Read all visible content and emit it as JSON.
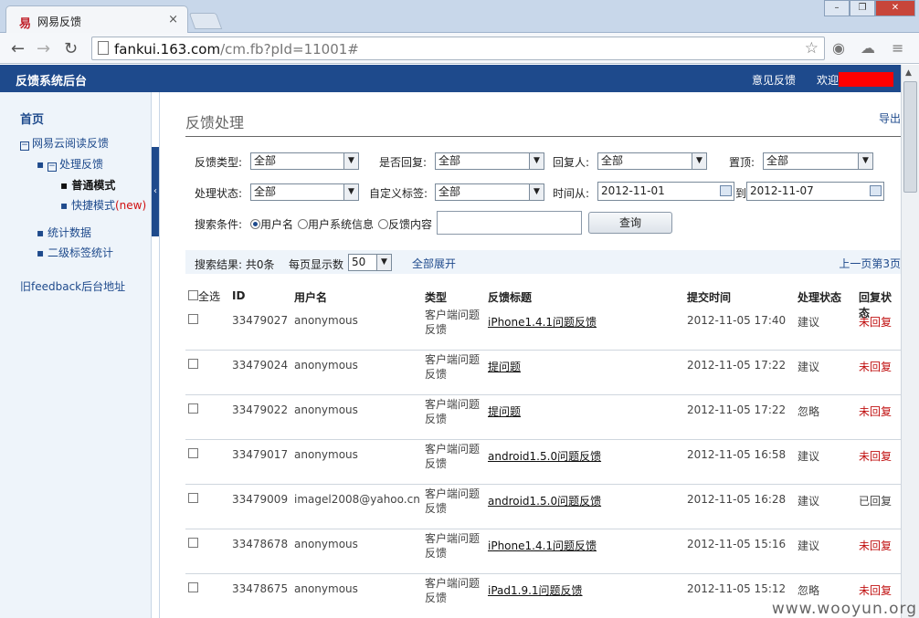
{
  "browser": {
    "tab_title": "网易反馈",
    "tab_close": "×",
    "url_host": "fankui.163.com",
    "url_rest": "/cm.fb?pId=11001#"
  },
  "header": {
    "app_title": "反馈系统后台",
    "feedback_link": "意见反馈",
    "welcome": "欢迎:"
  },
  "sidebar": {
    "home": "首页",
    "group": "网易云阅读反馈",
    "handle": "处理反馈",
    "normal_mode": "普通模式",
    "quick_mode": "快捷模式",
    "quick_new": "(new)",
    "stats": "统计数据",
    "tag_stats": "二级标签统计",
    "old_link": "旧feedback后台地址"
  },
  "main": {
    "title": "反馈处理",
    "export": "导出"
  },
  "filters": {
    "type_label": "反馈类型:",
    "type_value": "全部",
    "replied_label": "是否回复:",
    "replied_value": "全部",
    "replier_label": "回复人:",
    "replier_value": "全部",
    "top_label": "置顶:",
    "top_value": "全部",
    "status_label": "处理状态:",
    "status_value": "全部",
    "tag_label": "自定义标签:",
    "tag_value": "全部",
    "from_label": "时间从:",
    "from_value": "2012-11-01",
    "to_label": "到",
    "to_value": "2012-11-07",
    "cond_label": "搜索条件:",
    "opt_user": "用户名",
    "opt_sysinfo": "用户系统信息",
    "opt_content": "反馈内容",
    "search_value": "",
    "query_button": "查询"
  },
  "results": {
    "summary": "搜索结果: 共0条",
    "per_page_label": "每页显示数",
    "per_page_value": "50",
    "expand_all": "全部展开",
    "pager": "上一页第3页"
  },
  "table": {
    "headers": {
      "select_all": "全选",
      "id": "ID",
      "user": "用户名",
      "type": "类型",
      "title": "反馈标题",
      "time": "提交时间",
      "status": "处理状态",
      "reply": "回复状态"
    },
    "rows": [
      {
        "id": "33479027",
        "user": "anonymous",
        "type": "客户端问题反馈",
        "title": "iPhone1.4.1问题反馈",
        "time": "2012-11-05 17:40",
        "status": "建议",
        "reply": "未回复"
      },
      {
        "id": "33479024",
        "user": "anonymous",
        "type": "客户端问题反馈",
        "title": "提问题",
        "time": "2012-11-05 17:22",
        "status": "建议",
        "reply": "未回复"
      },
      {
        "id": "33479022",
        "user": "anonymous",
        "type": "客户端问题反馈",
        "title": "提问题",
        "time": "2012-11-05 17:22",
        "status": "忽略",
        "reply": "未回复"
      },
      {
        "id": "33479017",
        "user": "anonymous",
        "type": "客户端问题反馈",
        "title": "android1.5.0问题反馈",
        "time": "2012-11-05 16:58",
        "status": "建议",
        "reply": "未回复"
      },
      {
        "id": "33479009",
        "user": "imagel2008@yahoo.cn",
        "type": "客户端问题反馈",
        "title": "android1.5.0问题反馈",
        "time": "2012-11-05 16:28",
        "status": "建议",
        "reply": "已回复"
      },
      {
        "id": "33478678",
        "user": "anonymous",
        "type": "客户端问题反馈",
        "title": "iPhone1.4.1问题反馈",
        "time": "2012-11-05 15:16",
        "status": "建议",
        "reply": "未回复"
      },
      {
        "id": "33478675",
        "user": "anonymous",
        "type": "客户端问题反馈",
        "title": "iPad1.9.1问题反馈",
        "time": "2012-11-05 15:12",
        "status": "忽略",
        "reply": "未回复"
      }
    ]
  },
  "watermark": "www.wooyun.org"
}
